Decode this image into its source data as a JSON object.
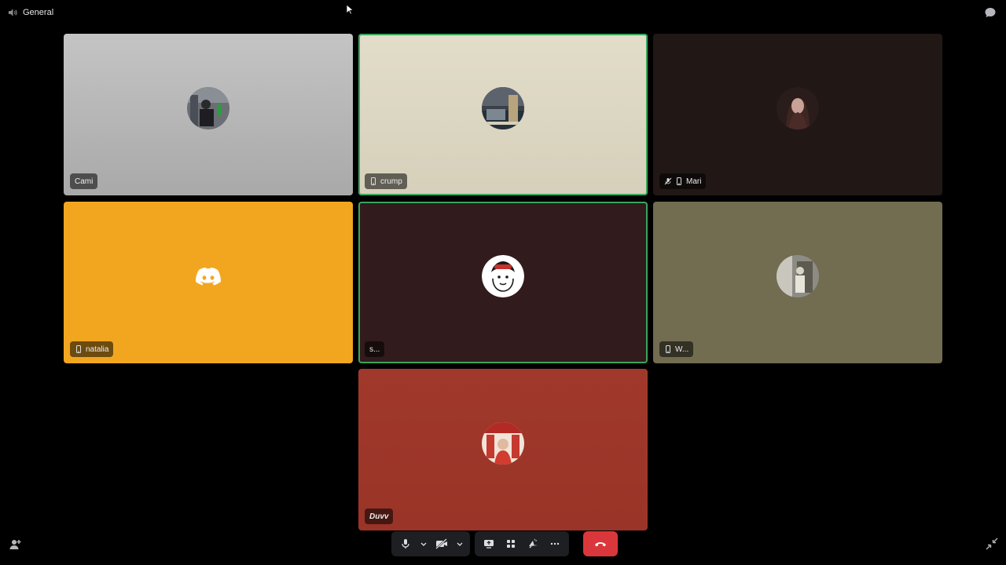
{
  "header": {
    "channel_name": "General",
    "speaker_icon": "speaker-icon",
    "chat_icon": "chat-bubble-icon"
  },
  "participants": [
    {
      "name": "Cami",
      "mobile": false,
      "muted": false,
      "speaking": false
    },
    {
      "name": "crump",
      "mobile": true,
      "muted": false,
      "speaking": true
    },
    {
      "name": "Mari",
      "mobile": true,
      "muted": true,
      "speaking": false
    },
    {
      "name": "natalia",
      "mobile": true,
      "muted": false,
      "speaking": false
    },
    {
      "name": "s...",
      "mobile": false,
      "muted": false,
      "speaking": true
    },
    {
      "name": "W...",
      "mobile": true,
      "muted": false,
      "speaking": false
    },
    {
      "name": "Duvv",
      "mobile": false,
      "muted": false,
      "speaking": false
    }
  ],
  "colors": {
    "speaking_border": "#3ba55d",
    "natalia_tile": "#f2a620",
    "duvv_tile": "#a0392b",
    "hangup": "#da373c",
    "controlbar_bg": "#1e1f22"
  },
  "controls": {
    "mic_icon": "microphone-icon",
    "camera_icon": "camera-off-icon",
    "screenshare_icon": "screen-share-icon",
    "activities_icon": "activities-icon",
    "soundboard_icon": "soundboard-icon",
    "more_icon": "more-icon",
    "hangup_icon": "phone-hangup-icon"
  }
}
